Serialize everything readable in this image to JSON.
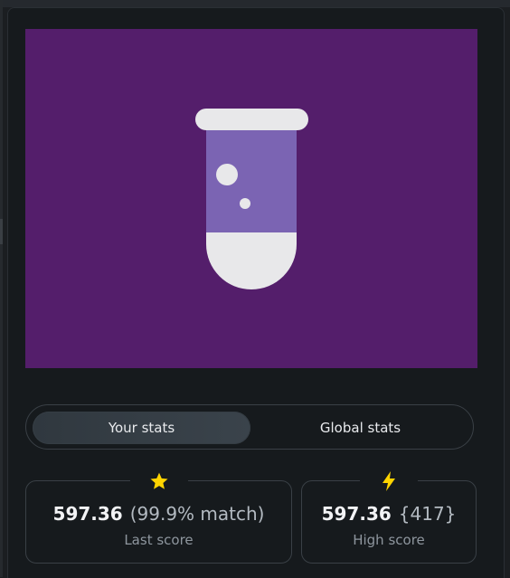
{
  "preview": {
    "background": "#541e6b",
    "icon": "test-tube-icon"
  },
  "stats_toggle": {
    "your_stats_label": "Your stats",
    "global_stats_label": "Global stats",
    "active": "your_stats"
  },
  "last_score_card": {
    "icon": "star-icon",
    "icon_color": "#ffd400",
    "value": "597.36",
    "extra": "(99.9% match)",
    "label": "Last score"
  },
  "high_score_card": {
    "icon": "lightning-icon",
    "icon_color": "#ffd400",
    "value": "597.36",
    "extra": "{417}",
    "label": "High score"
  }
}
